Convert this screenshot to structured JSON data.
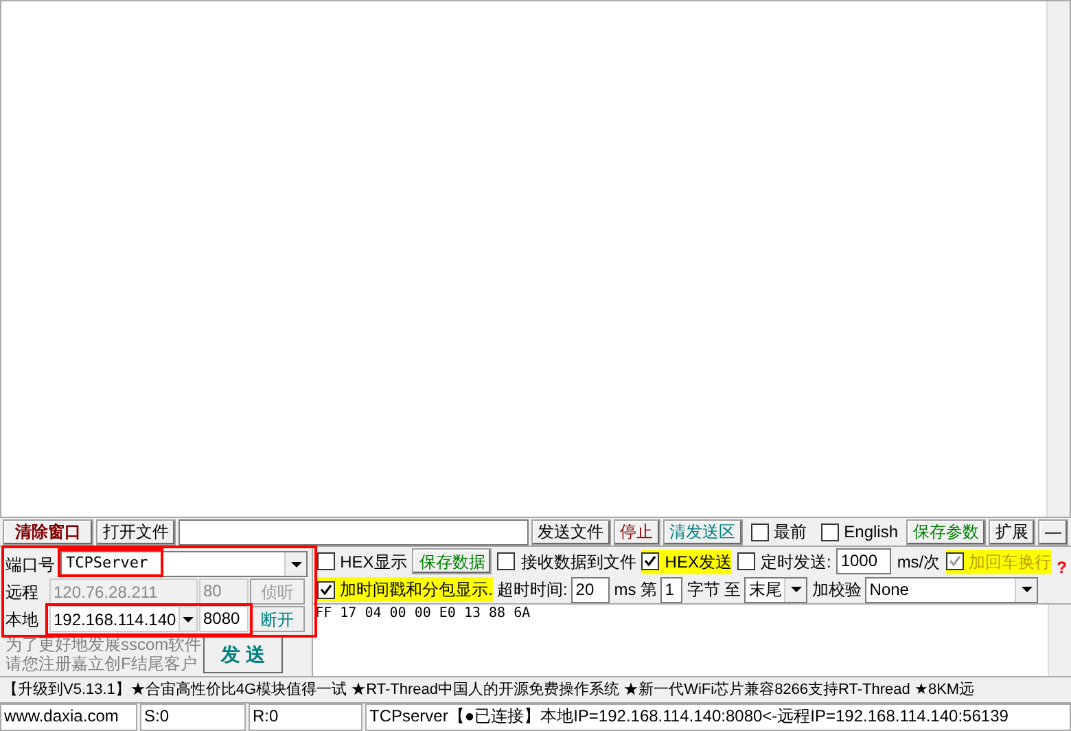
{
  "toolbar": [
    {
      "kind": "button",
      "label": "清除窗口",
      "color": "#800000"
    },
    {
      "kind": "button",
      "label": "打开文件",
      "color": "#000000"
    },
    {
      "kind": "field"
    },
    {
      "kind": "button",
      "label": "发送文件",
      "color": "#000000"
    },
    {
      "kind": "button",
      "label": "停止",
      "color": "#800000"
    },
    {
      "kind": "button",
      "label": "清发送区",
      "color": "#008080"
    },
    {
      "kind": "checkbox",
      "label": "最前",
      "checked": false
    },
    {
      "kind": "checkbox",
      "label": "English",
      "checked": false
    },
    {
      "kind": "button",
      "label": "保存参数",
      "color": "#008000"
    },
    {
      "kind": "button",
      "label": "扩展",
      "color": "#000000"
    },
    {
      "kind": "button",
      "label": "—"
    }
  ],
  "port": {
    "label": "端口号",
    "value": "TCPServer"
  },
  "remote": {
    "label": "远程",
    "ip": "120.76.28.211",
    "port": "80",
    "button": "侦听",
    "disabled": true
  },
  "local": {
    "label": "本地",
    "ip": "192.168.114.140",
    "port": "8080",
    "button": "断开",
    "disabled": false
  },
  "options_row_1": [
    {
      "kind": "checkbox",
      "label": "HEX显示",
      "checked": false,
      "highlight": false
    },
    {
      "kind": "button",
      "label": "保存数据",
      "color": "#008000"
    },
    {
      "kind": "checkbox",
      "label": "接收数据到文件",
      "checked": false,
      "highlight": false
    },
    {
      "kind": "checkbox",
      "label": "HEX发送",
      "checked": true,
      "highlight": true
    },
    {
      "kind": "checkbox",
      "label": "定时发送:",
      "checked": false,
      "highlight": false
    },
    {
      "kind": "field",
      "value": "1000"
    },
    {
      "kind": "text",
      "label": "ms/次"
    },
    {
      "kind": "checkbox",
      "label": "加回车换行",
      "checked": true,
      "highlight": true,
      "disabled": true
    },
    {
      "kind": "help",
      "label": "?"
    }
  ],
  "options_row_2": [
    {
      "kind": "checkbox",
      "label": "加时间戳和分包显示.",
      "checked": true,
      "highlight": true
    },
    {
      "kind": "text",
      "label": "超时时间:"
    },
    {
      "kind": "field",
      "value": "20"
    },
    {
      "kind": "text",
      "label": "ms"
    },
    {
      "kind": "text",
      "label": "第"
    },
    {
      "kind": "field",
      "value": "1"
    },
    {
      "kind": "text",
      "label": "字节"
    },
    {
      "kind": "text",
      "label": "至"
    },
    {
      "kind": "select",
      "value": "末尾"
    },
    {
      "kind": "text",
      "label": "加校验"
    },
    {
      "kind": "select",
      "value": "None",
      "wide": true
    }
  ],
  "send_text": "FF 17 04 00 00 E0 13 88 6A",
  "promo": [
    "为了更好地发展sscom软件",
    "请您注册嘉立创F结尾客户"
  ],
  "send_button": "发 送",
  "ticker": "【升级到V5.13.1】★合宙高性价比4G模块值得一试 ★RT-Thread中国人的开源免费操作系统 ★新一代WiFi芯片兼容8266支持RT-Thread ★8KM远",
  "status_bar": [
    "www.daxia.com",
    "S:0",
    "R:0",
    "TCPserver【●已连接】本地IP=192.168.114.140:8080<-远程IP=192.168.114.140:56139"
  ]
}
